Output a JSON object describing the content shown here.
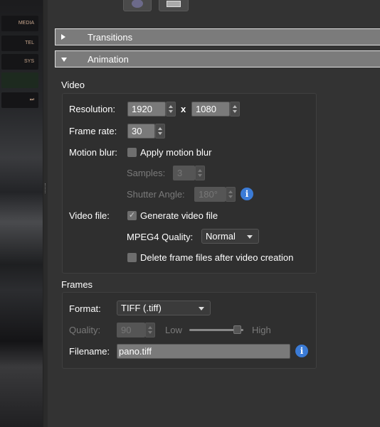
{
  "photo": {
    "buttons": [
      "MEDIA",
      "TEL",
      "SYS",
      "",
      "⏭"
    ]
  },
  "toolbar": {
    "buttons": [
      {
        "icon": "gear-icon"
      },
      {
        "icon": "monitor-icon"
      }
    ]
  },
  "sections": {
    "transitions": "Transitions",
    "animation": "Animation"
  },
  "video": {
    "title": "Video",
    "resolution_label": "Resolution:",
    "width": "1920",
    "x_label": "x",
    "height": "1080",
    "frame_rate_label": "Frame rate:",
    "frame_rate": "30",
    "motion_blur_label": "Motion blur:",
    "apply_motion_blur": "Apply motion blur",
    "apply_motion_blur_checked": false,
    "samples_label": "Samples:",
    "samples": "3",
    "shutter_label": "Shutter Angle:",
    "shutter": "180°",
    "video_file_label": "Video file:",
    "generate_video": "Generate video file",
    "generate_video_checked": true,
    "mpeg_label": "MPEG4 Quality:",
    "mpeg_quality": "Normal",
    "delete_frames": "Delete frame files after video creation",
    "delete_frames_checked": false
  },
  "frames": {
    "title": "Frames",
    "format_label": "Format:",
    "format": "TIFF (.tiff)",
    "quality_label": "Quality:",
    "quality": "90",
    "low": "Low",
    "high": "High",
    "quality_slider_percent": 90,
    "filename_label": "Filename:",
    "filename": "pano.tiff"
  },
  "colors": {
    "panel": "#333333",
    "header": "#7b7b7b",
    "info": "#3b7bd6"
  }
}
